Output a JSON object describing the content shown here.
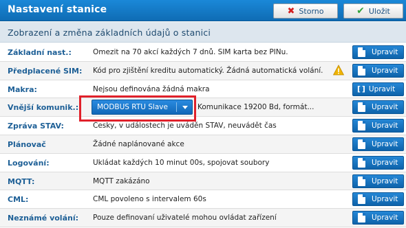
{
  "header": {
    "title": "Nastavení stanice",
    "storno_label": "Storno",
    "ulozit_label": "Uložit"
  },
  "subheader": {
    "title": "Zobrazení a změna základních údajů o stanici"
  },
  "edit_label": "Upravit",
  "rows": [
    {
      "label": "Základní nast.:",
      "value": "Omezit na 70 akcí každých 7 dnů. SIM karta bez PINu."
    },
    {
      "label": "Předplacené SIM:",
      "value": "Kód pro zjištění kreditu automatický. Žádná automatická volání."
    },
    {
      "label": "Makra:",
      "value": "Nejsou definována žádná makra"
    },
    {
      "label": "Vnější komunik.:",
      "dropdown": "MODBUS RTU Slave",
      "value": "Komunikace 19200 Bd, formát..."
    },
    {
      "label": "Zpráva STAV:",
      "value": "Česky, v událostech je uváděn STAV, neuvádět čas"
    },
    {
      "label": "Plánovač",
      "value": "Žádné naplánované akce"
    },
    {
      "label": "Logování:",
      "value": "Ukládat každých 10 minut 00s, spojovat soubory"
    },
    {
      "label": "MQTT:",
      "value": "MQTT zakázáno"
    },
    {
      "label": "CML:",
      "value": "CML povoleno s intervalem 60s"
    },
    {
      "label": "Neznámé volání:",
      "value": "Pouze definovaní uživatelé mohou ovládat zařízení"
    }
  ],
  "colors": {
    "header_blue": "#0f6cb4",
    "label_blue": "#1d5f96",
    "highlight_red": "#e0202a",
    "warning_yellow": "#f0b400"
  }
}
